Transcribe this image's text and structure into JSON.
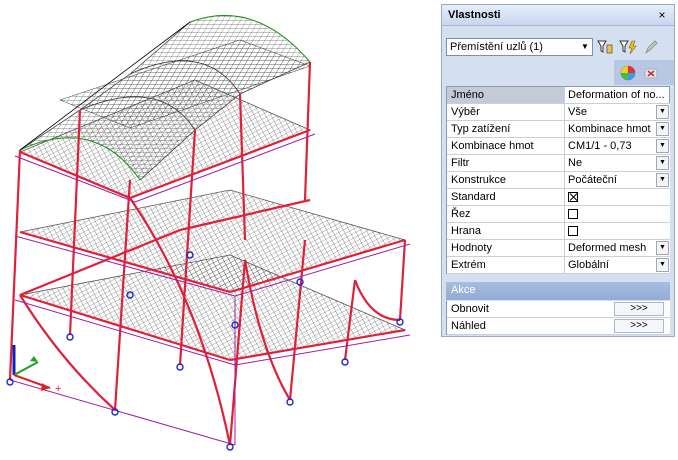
{
  "panel": {
    "title": "Vlastnosti",
    "close_glyph": "×",
    "selector_value": "Přemístění uzlů (1)",
    "toolbar_icons": [
      "filter-select-icon",
      "filter-lightning-icon",
      "pencil-icon",
      "color-palette-icon",
      "clear-icon"
    ]
  },
  "properties": [
    {
      "name": "Jméno",
      "value": "Deformation of no...",
      "type": "text",
      "header": true
    },
    {
      "name": "Výběr",
      "value": "Vše",
      "type": "dropdown"
    },
    {
      "name": "Typ zatížení",
      "value": "Kombinace hmot",
      "type": "dropdown"
    },
    {
      "name": "Kombinace hmot",
      "value": "CM1/1 - 0,73",
      "type": "dropdown"
    },
    {
      "name": "Filtr",
      "value": "Ne",
      "type": "dropdown"
    },
    {
      "name": "Konstrukce",
      "value": "Počáteční",
      "type": "dropdown"
    },
    {
      "name": "Standard",
      "value": "",
      "type": "checkbox",
      "checked": true
    },
    {
      "name": "Řez",
      "value": "",
      "type": "checkbox",
      "checked": false
    },
    {
      "name": "Hrana",
      "value": "",
      "type": "checkbox",
      "checked": false
    },
    {
      "name": "Hodnoty",
      "value": "Deformed mesh",
      "type": "dropdown"
    },
    {
      "name": "Extrém",
      "value": "Globální",
      "type": "dropdown"
    }
  ],
  "actions": {
    "header": "Akce",
    "items": [
      {
        "label": "Obnovit",
        "button": ">>>"
      },
      {
        "label": "Náhled",
        "button": ">>>"
      }
    ]
  },
  "colors": {
    "frame_members": "#e0203a",
    "deformed_members": "#a020a0",
    "mesh": "#3a3a3a",
    "arch_original": "#1a9a1a",
    "supports": "#1a2ad0",
    "axis_x": "#e02020",
    "axis_y": "#20a020",
    "axis_z": "#1020c0"
  }
}
